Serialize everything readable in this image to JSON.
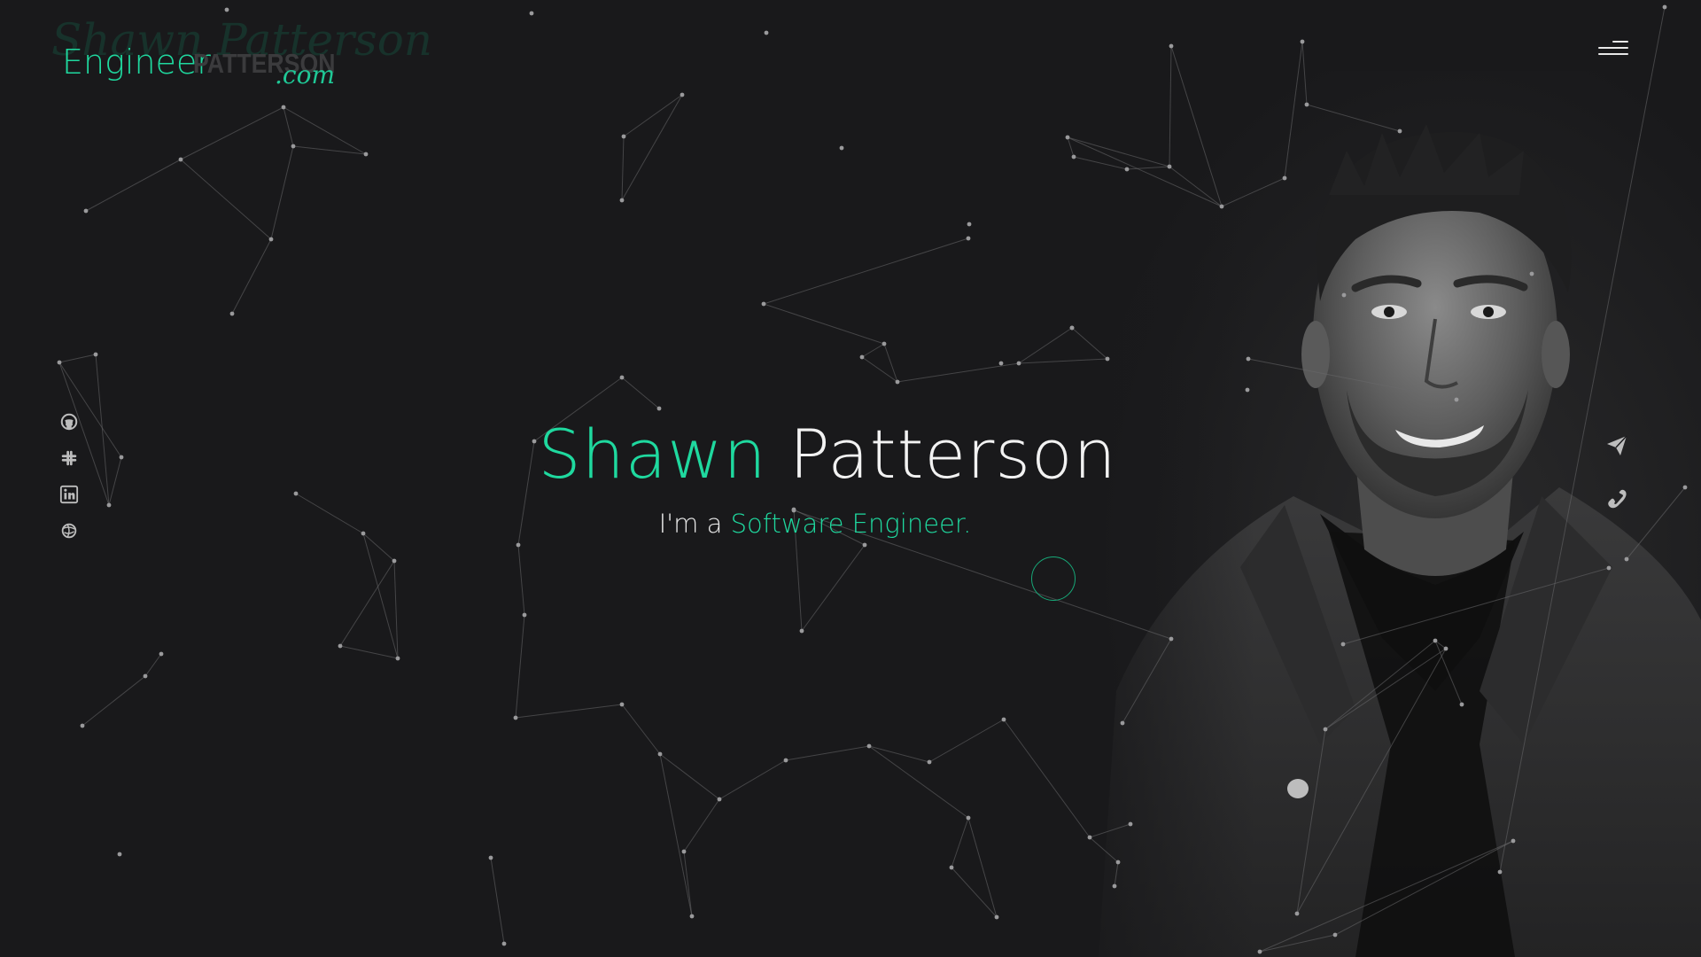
{
  "logo": {
    "script_text": "Shawn Patterson",
    "engineer": "Engineer",
    "patterson": "PATTERSON",
    "com": ".com"
  },
  "hero": {
    "first_name": "Shawn",
    "last_name": "Patterson",
    "subtitle_prefix": "I'm a ",
    "subtitle_role": "Software Engineer."
  },
  "social_links": [
    {
      "icon": "github-icon"
    },
    {
      "icon": "slack-icon"
    },
    {
      "icon": "linkedin-icon"
    },
    {
      "icon": "globe-icon"
    }
  ],
  "contact_links": [
    {
      "icon": "send-icon"
    },
    {
      "icon": "phone-icon"
    }
  ],
  "colors": {
    "accent": "#1fd99f",
    "background": "#19191b",
    "text": "#f2f2f2"
  }
}
